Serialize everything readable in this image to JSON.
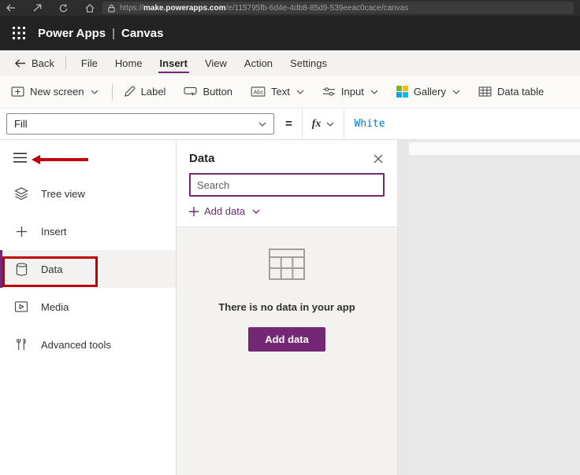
{
  "browser": {
    "url_scheme": "https://",
    "url_domain": "make.powerapps.com",
    "url_path": "/e/115795fb-6d4e-4db8-85d9-539eeac0cace/canvas"
  },
  "app_header": {
    "brand": "Power Apps",
    "separator": "|",
    "title": "Canvas"
  },
  "menu_bar": {
    "back_label": "Back",
    "items": [
      {
        "label": "File",
        "active": false
      },
      {
        "label": "Home",
        "active": false
      },
      {
        "label": "Insert",
        "active": true
      },
      {
        "label": "View",
        "active": false
      },
      {
        "label": "Action",
        "active": false
      },
      {
        "label": "Settings",
        "active": false
      }
    ]
  },
  "toolbar": {
    "items": [
      {
        "label": "New screen",
        "has_dropdown": true
      },
      {
        "label": "Label",
        "has_dropdown": false
      },
      {
        "label": "Button",
        "has_dropdown": false
      },
      {
        "label": "Text",
        "has_dropdown": true
      },
      {
        "label": "Input",
        "has_dropdown": true
      },
      {
        "label": "Gallery",
        "has_dropdown": true
      },
      {
        "label": "Data table",
        "has_dropdown": false
      }
    ]
  },
  "formula_bar": {
    "property": "Fill",
    "equals_sign": "=",
    "fx_label": "fx",
    "formula": "White"
  },
  "sidebar": {
    "items": [
      {
        "label": "Tree view",
        "selected": false
      },
      {
        "label": "Insert",
        "selected": false
      },
      {
        "label": "Data",
        "selected": true
      },
      {
        "label": "Media",
        "selected": false
      },
      {
        "label": "Advanced tools",
        "selected": false
      }
    ]
  },
  "data_panel": {
    "title": "Data",
    "search_placeholder": "Search",
    "add_data_label": "Add data",
    "empty_message": "There is no data in your app",
    "add_data_button": "Add data"
  },
  "icons": {
    "text_glyph": "Abc"
  },
  "colors": {
    "accent_purple": "#742774",
    "formula_blue": "#0078d4",
    "annotation_red": "#c00000"
  }
}
